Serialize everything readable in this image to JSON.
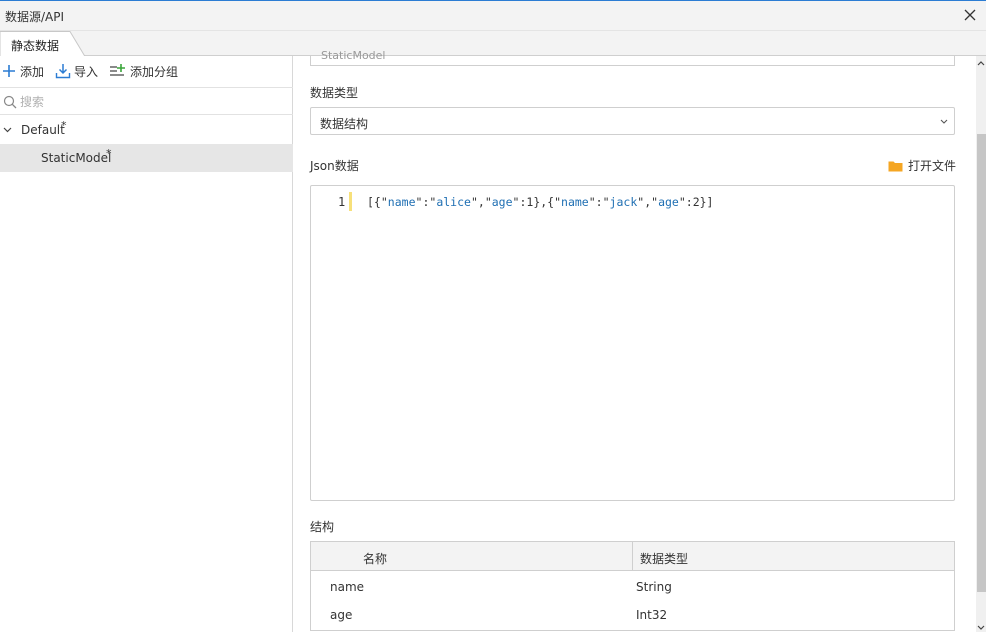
{
  "window": {
    "title": "数据源/API"
  },
  "tabs": [
    {
      "label": "静态数据"
    }
  ],
  "left_toolbar": {
    "add_label": "添加",
    "import_label": "导入",
    "add_group_label": "添加分组"
  },
  "search": {
    "placeholder": "搜索",
    "value": ""
  },
  "tree": {
    "groups": [
      {
        "label": "Default",
        "modified_mark": "*",
        "expanded": true,
        "items": [
          {
            "label": "StaticModel",
            "modified_mark": "*",
            "selected": true
          }
        ]
      }
    ]
  },
  "form": {
    "top_field_value": "StaticModel",
    "data_type_label": "数据类型",
    "data_type_value": "数据结构",
    "json_label": "Json数据",
    "open_file_label": "打开文件",
    "editor": {
      "line_number": "1",
      "code": "[{\"name\":\"alice\",\"age\":1},{\"name\":\"jack\",\"age\":2}]"
    },
    "structure_label": "结构",
    "structure_table": {
      "headers": [
        "名称",
        "数据类型"
      ],
      "rows": [
        [
          "name",
          "String"
        ],
        [
          "age",
          "Int32"
        ]
      ]
    }
  },
  "colors": {
    "accent": "#2b7cd3",
    "folder": "#f5a623",
    "selection": "#e6e6e6",
    "json_string": "#1f6fb3",
    "line_marker": "#f7e07a"
  },
  "icons": [
    "close-icon",
    "plus-icon",
    "import-icon",
    "add-group-icon",
    "search-icon",
    "chevron-down-icon",
    "folder-icon",
    "scroll-up-icon",
    "scroll-down-icon"
  ]
}
